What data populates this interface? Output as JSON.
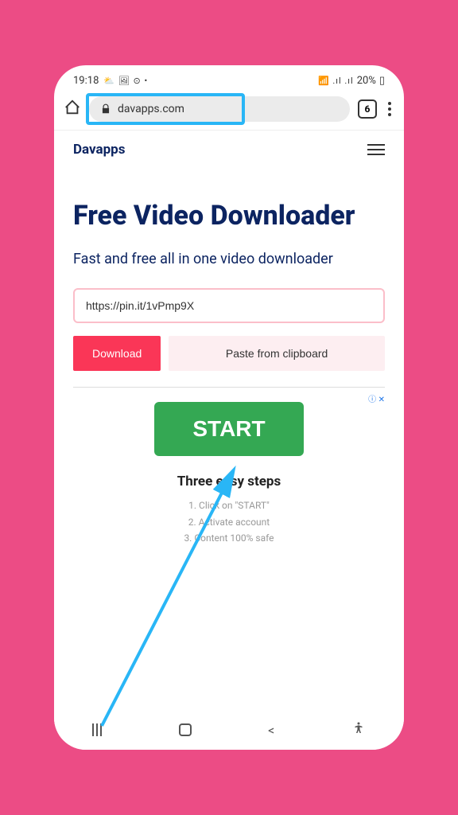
{
  "status_bar": {
    "time": "19:18",
    "icons_left": "⛅ 🖼 ⊙ •",
    "signal": "📶 .ıl .ıl",
    "battery": "20%",
    "battery_icon": "▯"
  },
  "browser": {
    "url": "davapps.com",
    "tab_count": "6"
  },
  "site": {
    "logo": "Davapps"
  },
  "hero": {
    "title": "Free Video Downloader",
    "subtitle": "Fast and free all in one video downloader"
  },
  "form": {
    "url_value": "https://pin.it/1vPmp9X",
    "download_label": "Download",
    "paste_label": "Paste from clipboard"
  },
  "ad": {
    "badge": "ⓘ ✕",
    "start_label": "START",
    "heading": "Three easy steps",
    "step1": "1. Click on \"START\"",
    "step2": "2. Activate account",
    "step3": "3. Content 100% safe"
  }
}
